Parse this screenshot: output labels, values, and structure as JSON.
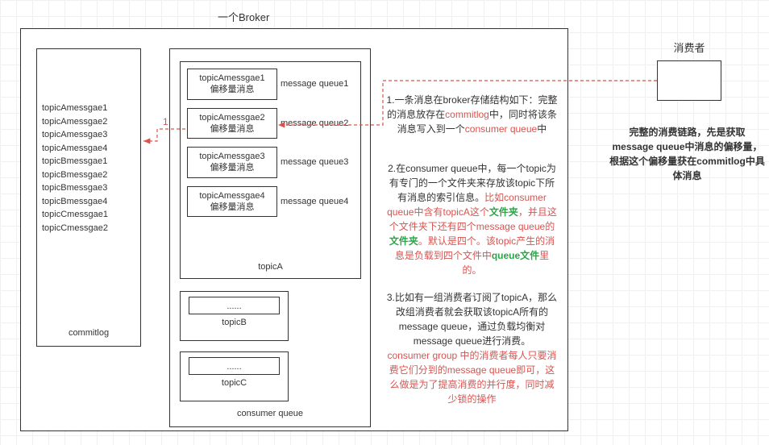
{
  "title": "一个Broker",
  "commitlog": {
    "label": "commitlog",
    "items": [
      "topicAmessgae1",
      "topicAmessgae2",
      "topicAmessgae3",
      "topicAmessgae4",
      "topicBmessgae1",
      "topicBmessgae2",
      "topicBmessgae3",
      "topicBmessgae4",
      "topicCmessgae1",
      "topicCmessgae2"
    ]
  },
  "consumerQueue": {
    "label": "consumer queue",
    "topicA": {
      "label": "topicA",
      "items": [
        {
          "name": "topicAmessgae1",
          "sub": "偏移量消息",
          "queue": "message queue1"
        },
        {
          "name": "topicAmessgae2",
          "sub": "偏移量消息",
          "queue": "message queue2"
        },
        {
          "name": "topicAmessgae3",
          "sub": "偏移量消息",
          "queue": "message queue3"
        },
        {
          "name": "topicAmessgae4",
          "sub": "偏移量消息",
          "queue": "message queue4"
        }
      ]
    },
    "topicB": {
      "label": "topicB",
      "placeholder": "......"
    },
    "topicC": {
      "label": "topicC",
      "placeholder": "......"
    }
  },
  "consumer": {
    "label": "消费者",
    "note": "完整的消费链路，先是获取message queue中消息的偏移量，根据这个偏移量获在commitlog中具体消息"
  },
  "annotations": {
    "arrow1": "1",
    "p1a": "1.一条消息在broker存储结构如下：完整的消息放存在",
    "p1b": "commitlog",
    "p1c": "中，同时将该条消息写入到一个",
    "p1d": "consumer queue",
    "p1e": "中",
    "p2a": "2.在consumer queue中，每一个topic为有专门的一个文件夹来存放该topic下所有消息的索引信息。",
    "p2b": "比如consumer queue中含有topicA这个",
    "p2c": "文件夹",
    "p2d": "，并且这个文件夹下还有四个message queue的",
    "p2e": "文件夹",
    "p2f": "。默认是四个。该topic产生的消息是负载到四个文件中",
    "p2g": "queue文件",
    "p2h": "里的。",
    "p3a": "3.比如有一组消费者订阅了topicA，那么改组消费者就会获取该topicA所有的message queue，通过负载均衡对message queue进行消费。",
    "p3b": "consumer group 中的消费者每人只要消费它们分到的message queue即可，这么做是为了提高消费的并行度，同时减少锁的操作"
  }
}
